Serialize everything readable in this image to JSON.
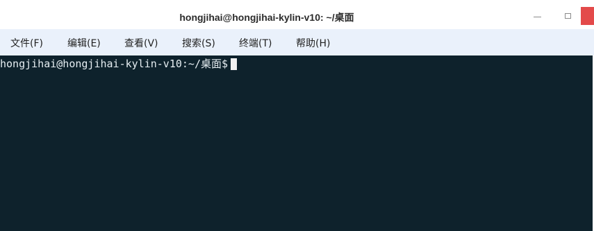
{
  "window": {
    "title": "hongjihai@hongjihai-kylin-v10: ~/桌面"
  },
  "menu": {
    "items": [
      {
        "label": "文件(F)"
      },
      {
        "label": "编辑(E)"
      },
      {
        "label": "查看(V)"
      },
      {
        "label": "搜索(S)"
      },
      {
        "label": "终端(T)"
      },
      {
        "label": "帮助(H)"
      }
    ]
  },
  "terminal": {
    "prompt": "hongjihai@hongjihai-kylin-v10:~/桌面$"
  },
  "icons": {
    "minimize": "minimize-icon",
    "maximize": "maximize-icon",
    "close": "close-icon"
  },
  "colors": {
    "terminal_bg": "#0e222c",
    "menubar_bg": "#eaf1fb",
    "close_button": "#e34a4a"
  }
}
